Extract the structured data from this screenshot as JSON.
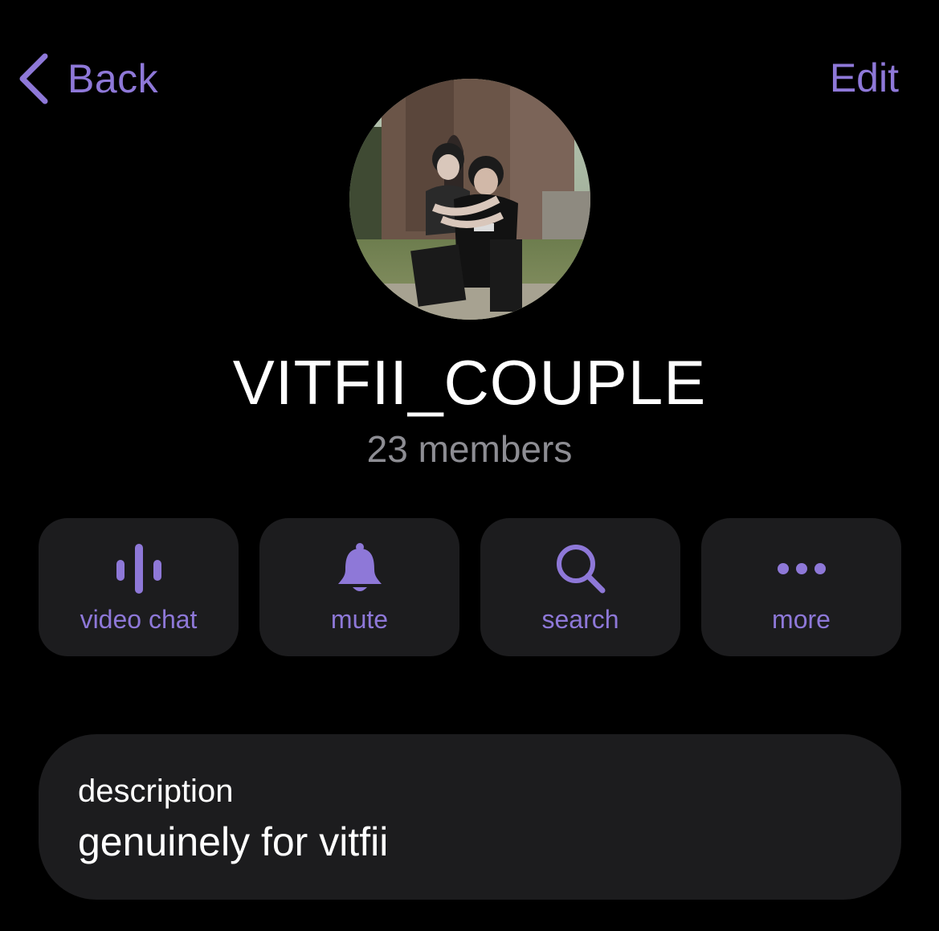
{
  "nav": {
    "back_label": "Back",
    "edit_label": "Edit"
  },
  "profile": {
    "name": "VITFII_COUPLE",
    "members": "23 members",
    "avatar": "group-photo"
  },
  "actions": [
    {
      "label": "video chat",
      "icon": "voice-wave-icon"
    },
    {
      "label": "mute",
      "icon": "bell-icon"
    },
    {
      "label": "search",
      "icon": "search-icon"
    },
    {
      "label": "more",
      "icon": "ellipsis-icon"
    }
  ],
  "description": {
    "caption": "description",
    "text": "genuinely for vitfii"
  },
  "colors": {
    "accent": "#8e78d8",
    "background": "#000000",
    "card": "#1c1c1e",
    "secondary_text": "#8d8d93"
  }
}
